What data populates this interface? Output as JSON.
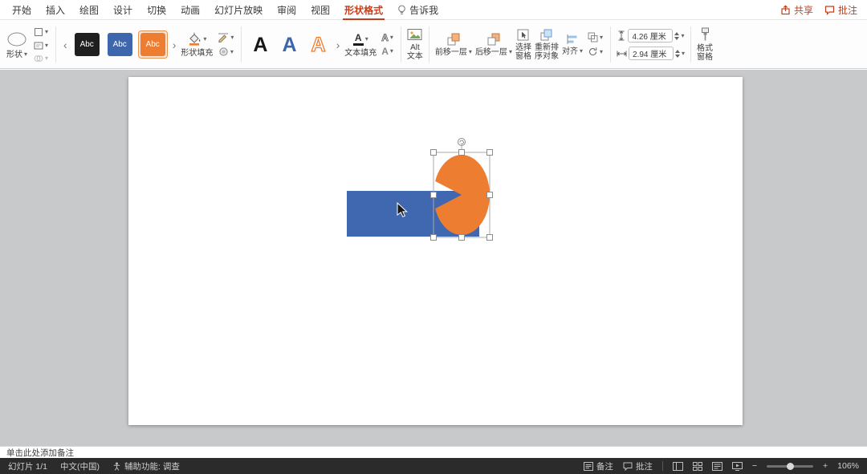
{
  "app": {
    "accent_color": "#C43E1C"
  },
  "menubar": {
    "tabs": [
      "开始",
      "插入",
      "绘图",
      "设计",
      "切换",
      "动画",
      "幻灯片放映",
      "审阅",
      "视图",
      "形状格式",
      "告诉我"
    ],
    "active_tab": "形状格式",
    "share_label": "共享",
    "comments_label": "批注"
  },
  "icons": {
    "chevron_down": "▾",
    "gallery_prev": "‹",
    "gallery_next": "›",
    "zoom_out": "−",
    "zoom_in": "+"
  },
  "ribbon": {
    "shapes": {
      "label": "形状"
    },
    "styles": {
      "swatches": [
        {
          "label": "Abc",
          "color": "#1F1F1F"
        },
        {
          "label": "Abc",
          "color": "#3E66AD"
        },
        {
          "label": "Abc",
          "color": "#ED7D31",
          "selected": true
        }
      ]
    },
    "shape_fill": {
      "label": "形状填充"
    },
    "wordart": {
      "letters": [
        "A",
        "A",
        "A"
      ]
    },
    "text_fill": {
      "label": "文本填充",
      "icon_letter": "A"
    },
    "alt_text": {
      "line1": "Alt",
      "line2": "文本"
    },
    "arrange": {
      "bring_forward": "前移一层",
      "send_backward": "后移一层",
      "selection_pane_line1": "选择",
      "selection_pane_line2": "窗格",
      "reorder_line1": "重新排",
      "reorder_line2": "序对象",
      "align": "对齐"
    },
    "size": {
      "height_value": "4.26 厘米",
      "width_value": "2.94 厘米"
    },
    "format_pane": {
      "line1": "格式",
      "line2": "窗格"
    }
  },
  "canvas": {
    "shape_colors": {
      "rectangle": "#4068B0",
      "pie": "#ED7D31"
    }
  },
  "notes": {
    "placeholder": "单击此处添加备注"
  },
  "statusbar": {
    "slide_indicator": "幻灯片 1/1",
    "language": "中文(中国)",
    "accessibility": "辅助功能: 调查",
    "notes_label": "备注",
    "comments_label": "批注",
    "zoom_level": "106%"
  }
}
